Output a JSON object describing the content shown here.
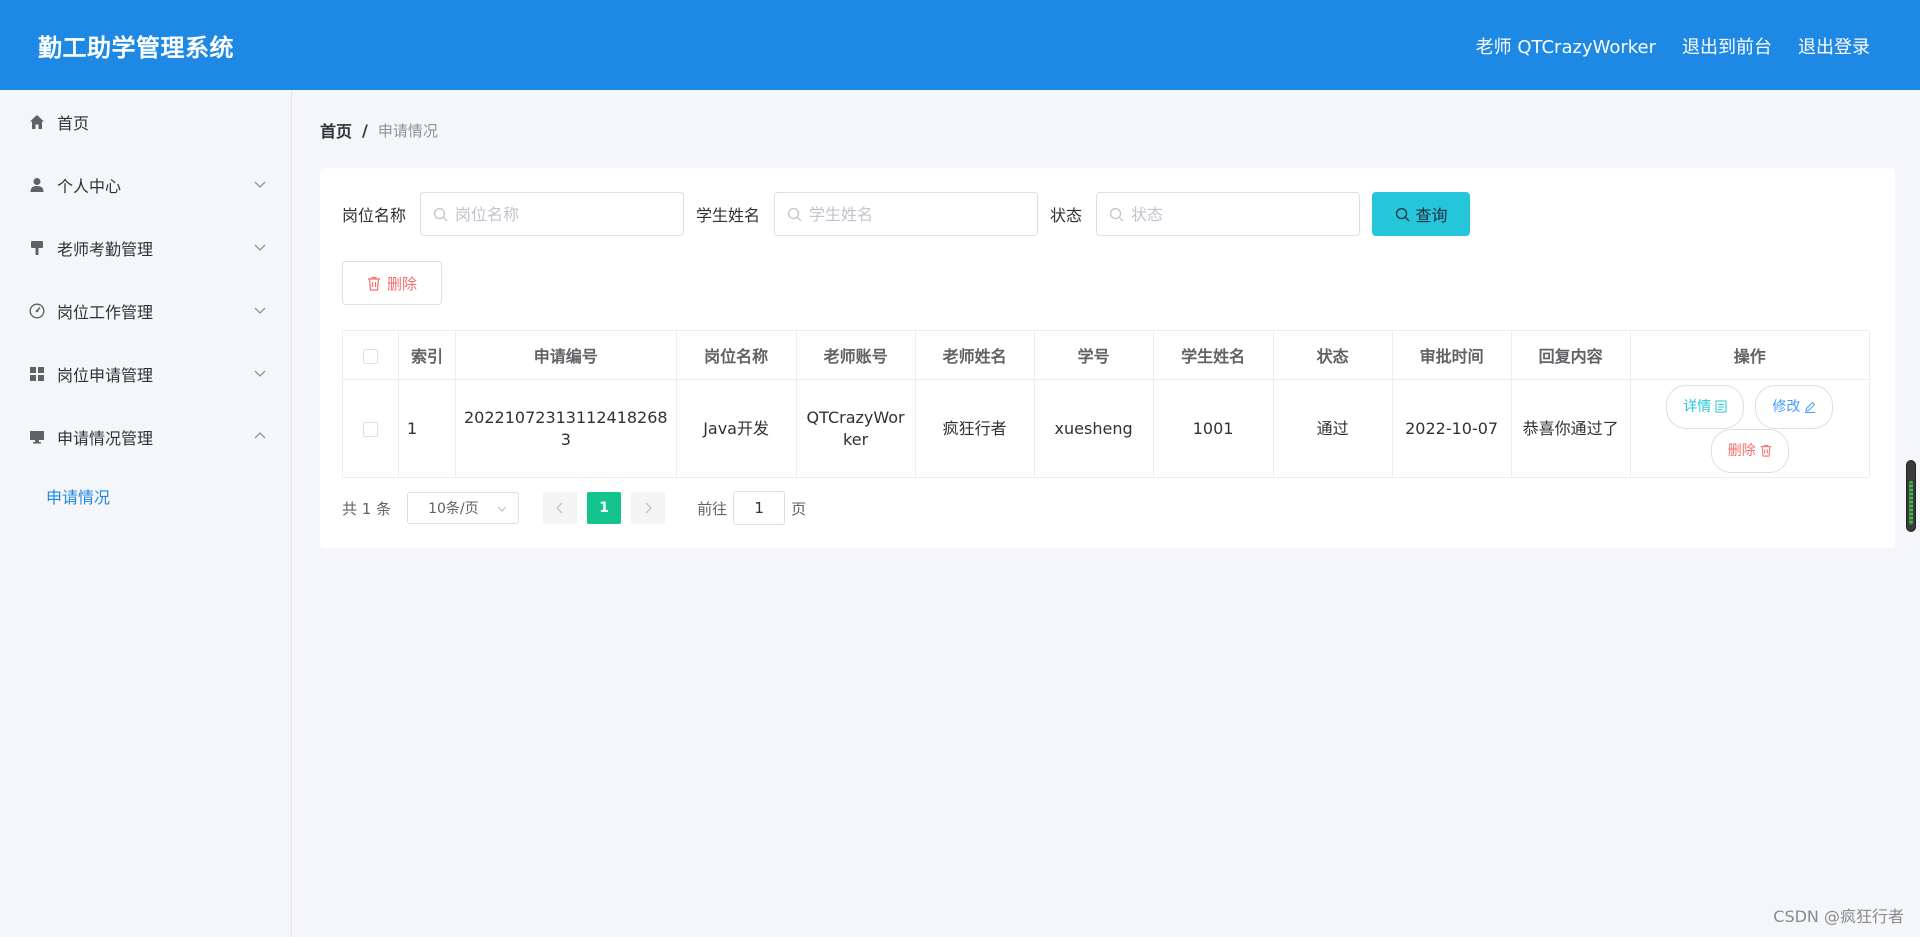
{
  "header": {
    "title": "勤工助学管理系统",
    "user": "老师 QTCrazyWorker",
    "front": "退出到前台",
    "logout": "退出登录"
  },
  "sidebar": {
    "items": [
      {
        "label": "首页",
        "icon": "home-icon",
        "arrow": ""
      },
      {
        "label": "个人中心",
        "icon": "user-icon",
        "arrow": "down"
      },
      {
        "label": "老师考勤管理",
        "icon": "brush-icon",
        "arrow": "down"
      },
      {
        "label": "岗位工作管理",
        "icon": "gauge-icon",
        "arrow": "down"
      },
      {
        "label": "岗位申请管理",
        "icon": "grid-icon",
        "arrow": "down"
      },
      {
        "label": "申请情况管理",
        "icon": "monitor-icon",
        "arrow": "up"
      }
    ],
    "sub_item": "申请情况"
  },
  "breadcrumb": {
    "home": "首页",
    "sep": "/",
    "current": "申请情况"
  },
  "filters": {
    "post_label": "岗位名称",
    "post_placeholder": "岗位名称",
    "student_label": "学生姓名",
    "student_placeholder": "学生姓名",
    "status_label": "状态",
    "status_placeholder": "状态",
    "query_label": "查询"
  },
  "toolbar": {
    "delete_label": "删除"
  },
  "table": {
    "headers": [
      "索引",
      "申请编号",
      "岗位名称",
      "老师账号",
      "老师姓名",
      "学号",
      "学生姓名",
      "状态",
      "审批时间",
      "回复内容",
      "操作"
    ],
    "rows": [
      {
        "index": "1",
        "app_no": "20221072313112418268 3",
        "post_name": "Java开发",
        "teacher_account": "QTCrazyWor ker",
        "teacher_name": "疯狂行者",
        "student_no": "xuesheng",
        "student_name": "1001",
        "status": "通过",
        "approve_time": "2022-10-07",
        "reply": "恭喜你通过了",
        "detail_label": "详情",
        "edit_label": "修改",
        "delete_label": "删除"
      }
    ]
  },
  "pagination": {
    "total": "共 1 条",
    "page_size": "10条/页",
    "current_page": "1",
    "goto_label": "前往",
    "goto_value": "1",
    "page_suffix": "页"
  },
  "watermark": "CSDN @疯狂行者",
  "colors": {
    "header": "#1e88e5",
    "query": "#26c6da",
    "active_page": "#13c48e",
    "danger": "#f56c6c",
    "primary": "#409eff"
  }
}
